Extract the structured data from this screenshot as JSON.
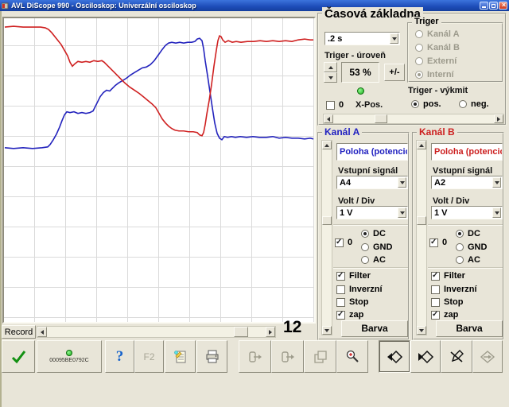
{
  "window": {
    "title": "AVL DiScope 990 - Osciloskop: Univerzální osciloskop"
  },
  "timebase": {
    "title": "Časová základna",
    "value": ".2 s",
    "trigger": {
      "title": "Triger",
      "options": [
        {
          "label": "Kanál A",
          "selected": false
        },
        {
          "label": "Kanál B",
          "selected": false
        },
        {
          "label": "Externí",
          "selected": false
        },
        {
          "label": "Interní",
          "selected": true
        }
      ]
    },
    "level_label": "Triger - úroveň",
    "level_value": "53 %",
    "plus_minus": "+/-",
    "slope_label": "Triger - výkmit",
    "slope_pos": {
      "label": "pos.",
      "selected": true
    },
    "slope_neg": {
      "label": "neg.",
      "selected": false
    },
    "xpos": {
      "cb_label": "0",
      "checked": false,
      "label": "X-Pos."
    }
  },
  "channels": [
    {
      "title": "Kanál A",
      "color": "#2121c0",
      "poloha": "Poloha (potencio",
      "input_label": "Vstupní signál",
      "input_value": "A4",
      "volt_label": "Volt / Div",
      "volt_value": "1 V",
      "zero": {
        "label": "0",
        "checked": true
      },
      "coupling": [
        {
          "label": "DC",
          "selected": true
        },
        {
          "label": "GND",
          "selected": false
        },
        {
          "label": "AC",
          "selected": false
        }
      ],
      "opts": [
        {
          "label": "Filter",
          "checked": true
        },
        {
          "label": "Inverzní",
          "checked": false
        },
        {
          "label": "Stop",
          "checked": false
        },
        {
          "label": "zap",
          "checked": true
        }
      ],
      "barva": "Barva"
    },
    {
      "title": "Kanál B",
      "color": "#cc1f1f",
      "poloha": "Poloha (potencio",
      "input_label": "Vstupní signál",
      "input_value": "A2",
      "volt_label": "Volt / Div",
      "volt_value": "1 V",
      "zero": {
        "label": "0",
        "checked": true
      },
      "coupling": [
        {
          "label": "DC",
          "selected": true
        },
        {
          "label": "GND",
          "selected": false
        },
        {
          "label": "AC",
          "selected": false
        }
      ],
      "opts": [
        {
          "label": "Filter",
          "checked": true
        },
        {
          "label": "Inverzní",
          "checked": false
        },
        {
          "label": "Stop",
          "checked": false
        },
        {
          "label": "zap",
          "checked": true
        }
      ],
      "barva": "Barva"
    }
  ],
  "record": {
    "label": "Record",
    "count": "12"
  },
  "toolbar": {
    "device_code": "00095BE0792C",
    "help": "?",
    "f2": "F2"
  },
  "chart_data": {
    "type": "line",
    "title": "",
    "grid_color": "#dadada",
    "background": "#ffffff",
    "series": [
      {
        "name": "kanal-a-trace",
        "color": "#2323bd",
        "points": [
          [
            1,
            162
          ],
          [
            12,
            163
          ],
          [
            24,
            162
          ],
          [
            36,
            163
          ],
          [
            48,
            162
          ],
          [
            55,
            161
          ],
          [
            58,
            158
          ],
          [
            62,
            152
          ],
          [
            66,
            145
          ],
          [
            70,
            136
          ],
          [
            73,
            128
          ],
          [
            76,
            121
          ],
          [
            79,
            117
          ],
          [
            83,
            118
          ],
          [
            88,
            117
          ],
          [
            93,
            119
          ],
          [
            98,
            118
          ],
          [
            103,
            119
          ],
          [
            108,
            118
          ],
          [
            112,
            116
          ],
          [
            115,
            110
          ],
          [
            118,
            104
          ],
          [
            121,
            98
          ],
          [
            125,
            93
          ],
          [
            129,
            90
          ],
          [
            133,
            91
          ],
          [
            136,
            88
          ],
          [
            140,
            84
          ],
          [
            144,
            81
          ],
          [
            149,
            78
          ],
          [
            154,
            75
          ],
          [
            159,
            71
          ],
          [
            164,
            68
          ],
          [
            169,
            65
          ],
          [
            174,
            62
          ],
          [
            179,
            61
          ],
          [
            184,
            58
          ],
          [
            189,
            53
          ],
          [
            194,
            46
          ],
          [
            199,
            39
          ],
          [
            203,
            34
          ],
          [
            207,
            31
          ],
          [
            211,
            30
          ],
          [
            216,
            31
          ],
          [
            221,
            30
          ],
          [
            226,
            31
          ],
          [
            231,
            30
          ],
          [
            236,
            30
          ],
          [
            240,
            29
          ],
          [
            243,
            26
          ],
          [
            246,
            25
          ],
          [
            249,
            28
          ],
          [
            251,
            38
          ],
          [
            253,
            53
          ],
          [
            256,
            72
          ],
          [
            259,
            92
          ],
          [
            262,
            112
          ],
          [
            265,
            131
          ],
          [
            268,
            144
          ],
          [
            271,
            150
          ],
          [
            274,
            152
          ],
          [
            277,
            148
          ],
          [
            281,
            149
          ],
          [
            286,
            148
          ],
          [
            291,
            149
          ],
          [
            297,
            148
          ],
          [
            305,
            149
          ],
          [
            313,
            148
          ],
          [
            321,
            149
          ],
          [
            330,
            149
          ],
          [
            338,
            148
          ],
          [
            346,
            150
          ],
          [
            354,
            149
          ],
          [
            362,
            150
          ],
          [
            370,
            150
          ],
          [
            378,
            151
          ],
          [
            385,
            150
          ],
          [
            389,
            151
          ]
        ]
      },
      {
        "name": "kanal-b-trace",
        "color": "#cf2020",
        "points": [
          [
            1,
            11
          ],
          [
            12,
            10
          ],
          [
            24,
            11
          ],
          [
            36,
            11
          ],
          [
            46,
            11
          ],
          [
            52,
            12
          ],
          [
            56,
            14
          ],
          [
            60,
            18
          ],
          [
            64,
            23
          ],
          [
            68,
            28
          ],
          [
            72,
            33
          ],
          [
            76,
            40
          ],
          [
            80,
            47
          ],
          [
            83,
            55
          ],
          [
            86,
            60
          ],
          [
            89,
            57
          ],
          [
            93,
            54
          ],
          [
            98,
            55
          ],
          [
            103,
            54
          ],
          [
            108,
            55
          ],
          [
            113,
            53
          ],
          [
            118,
            54
          ],
          [
            123,
            53
          ],
          [
            126,
            55
          ],
          [
            130,
            59
          ],
          [
            135,
            64
          ],
          [
            141,
            70
          ],
          [
            147,
            76
          ],
          [
            152,
            81
          ],
          [
            158,
            86
          ],
          [
            164,
            90
          ],
          [
            170,
            94
          ],
          [
            175,
            98
          ],
          [
            181,
            103
          ],
          [
            186,
            107
          ],
          [
            191,
            112
          ],
          [
            195,
            119
          ],
          [
            199,
            126
          ],
          [
            203,
            131
          ],
          [
            207,
            135
          ],
          [
            211,
            138
          ],
          [
            215,
            140
          ],
          [
            220,
            141
          ],
          [
            226,
            141
          ],
          [
            232,
            142
          ],
          [
            238,
            142
          ],
          [
            243,
            143
          ],
          [
            246,
            146
          ],
          [
            249,
            147
          ],
          [
            251,
            143
          ],
          [
            253,
            133
          ],
          [
            255,
            120
          ],
          [
            258,
            103
          ],
          [
            261,
            83
          ],
          [
            264,
            60
          ],
          [
            267,
            40
          ],
          [
            269,
            28
          ],
          [
            271,
            22
          ],
          [
            273,
            23
          ],
          [
            275,
            27
          ],
          [
            278,
            30
          ],
          [
            282,
            28
          ],
          [
            287,
            30
          ],
          [
            292,
            29
          ],
          [
            298,
            30
          ],
          [
            306,
            29
          ],
          [
            314,
            29
          ],
          [
            322,
            28
          ],
          [
            330,
            29
          ],
          [
            338,
            28
          ],
          [
            346,
            29
          ],
          [
            354,
            28
          ],
          [
            362,
            29
          ],
          [
            370,
            27
          ],
          [
            378,
            26
          ],
          [
            385,
            27
          ],
          [
            389,
            27
          ]
        ]
      }
    ]
  }
}
